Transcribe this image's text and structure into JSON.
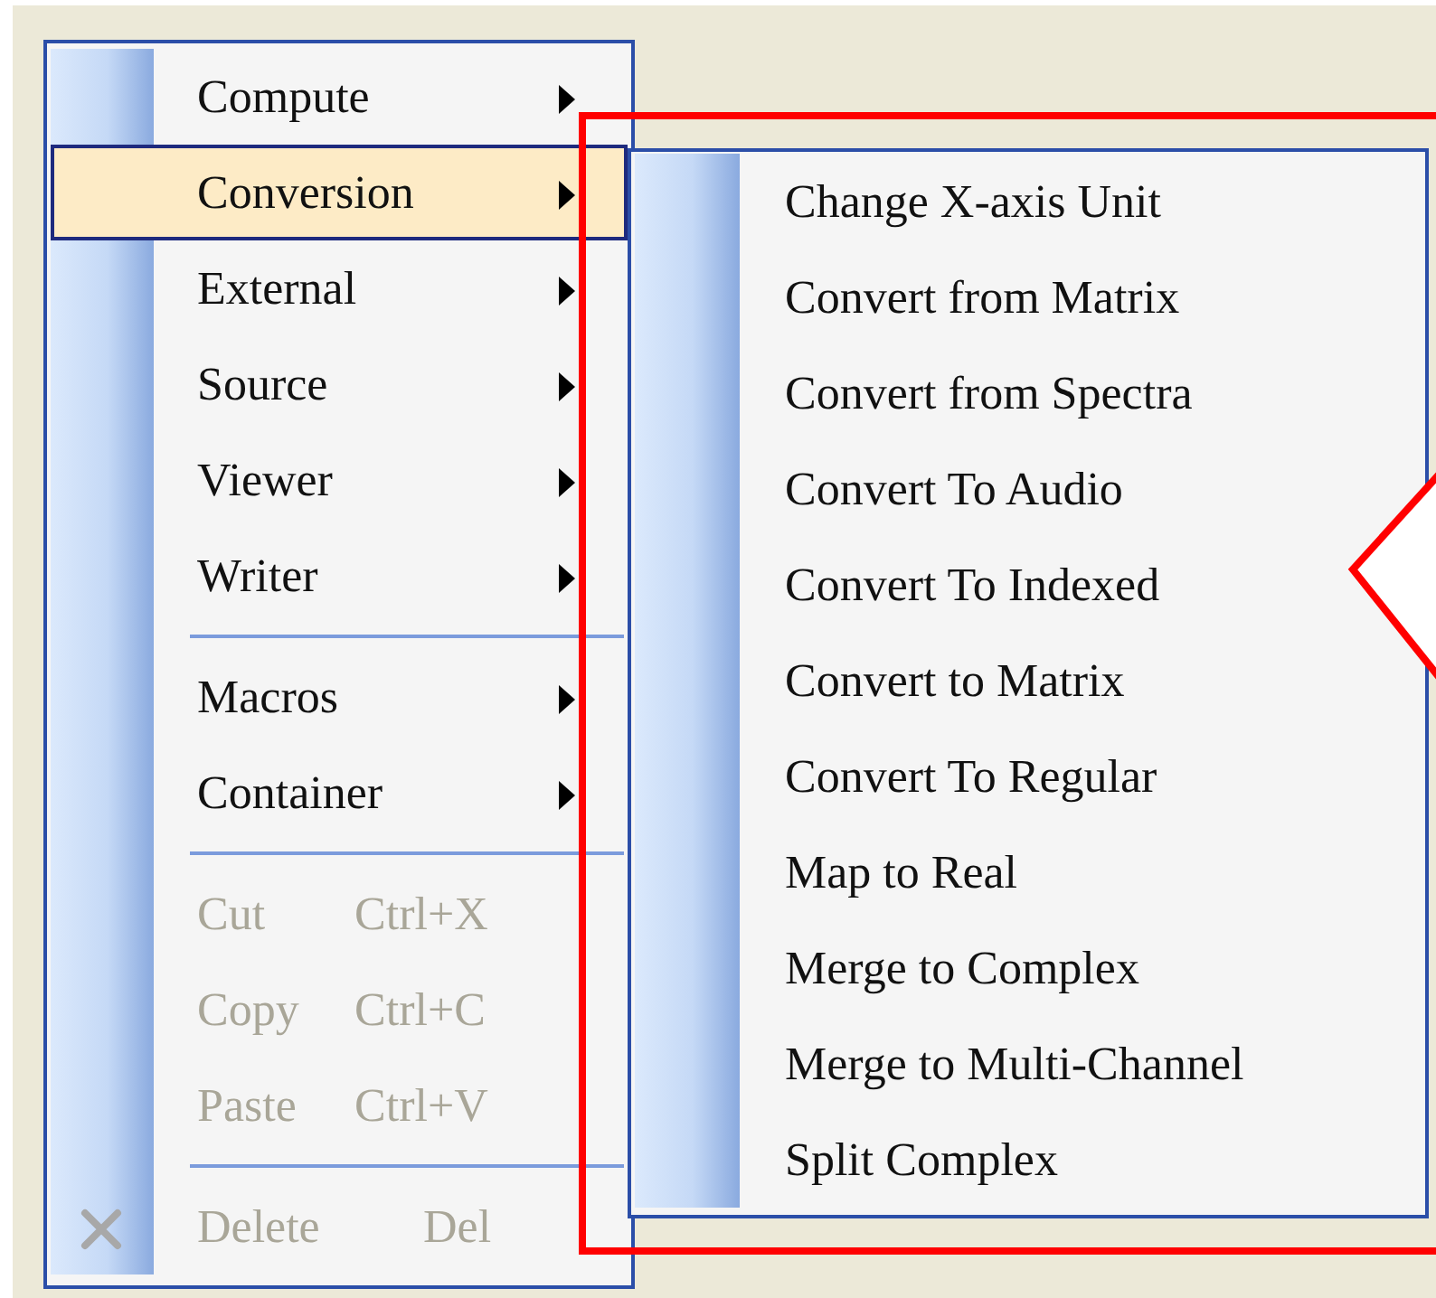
{
  "menu": {
    "items": [
      {
        "kind": "submenu",
        "label": "Compute",
        "selected": false
      },
      {
        "kind": "submenu",
        "label": "Conversion",
        "selected": true
      },
      {
        "kind": "submenu",
        "label": "External",
        "selected": false
      },
      {
        "kind": "submenu",
        "label": "Source",
        "selected": false
      },
      {
        "kind": "submenu",
        "label": "Viewer",
        "selected": false
      },
      {
        "kind": "submenu",
        "label": "Writer",
        "selected": false
      },
      {
        "kind": "separator"
      },
      {
        "kind": "submenu",
        "label": "Macros",
        "selected": false
      },
      {
        "kind": "submenu",
        "label": "Container",
        "selected": false
      },
      {
        "kind": "separator"
      },
      {
        "kind": "command",
        "label": "Cut",
        "shortcut": "Ctrl+X",
        "disabled": true,
        "selected": false
      },
      {
        "kind": "command",
        "label": "Copy",
        "shortcut": "Ctrl+C",
        "disabled": true,
        "selected": false
      },
      {
        "kind": "command",
        "label": "Paste",
        "shortcut": "Ctrl+V",
        "disabled": true,
        "selected": false
      },
      {
        "kind": "separator"
      },
      {
        "kind": "delete",
        "label": "Delete",
        "shortcut": "Del",
        "disabled": true,
        "selected": false
      }
    ]
  },
  "submenu": {
    "items": [
      {
        "label": "Change X-axis Unit"
      },
      {
        "label": "Convert from Matrix"
      },
      {
        "label": "Convert from Spectra"
      },
      {
        "label": "Convert To Audio"
      },
      {
        "label": "Convert To Indexed"
      },
      {
        "label": "Convert to Matrix"
      },
      {
        "label": "Convert To Regular"
      },
      {
        "label": "Map to Real"
      },
      {
        "label": "Merge to Complex"
      },
      {
        "label": "Merge to Multi-Channel"
      },
      {
        "label": "Split Complex"
      }
    ]
  }
}
